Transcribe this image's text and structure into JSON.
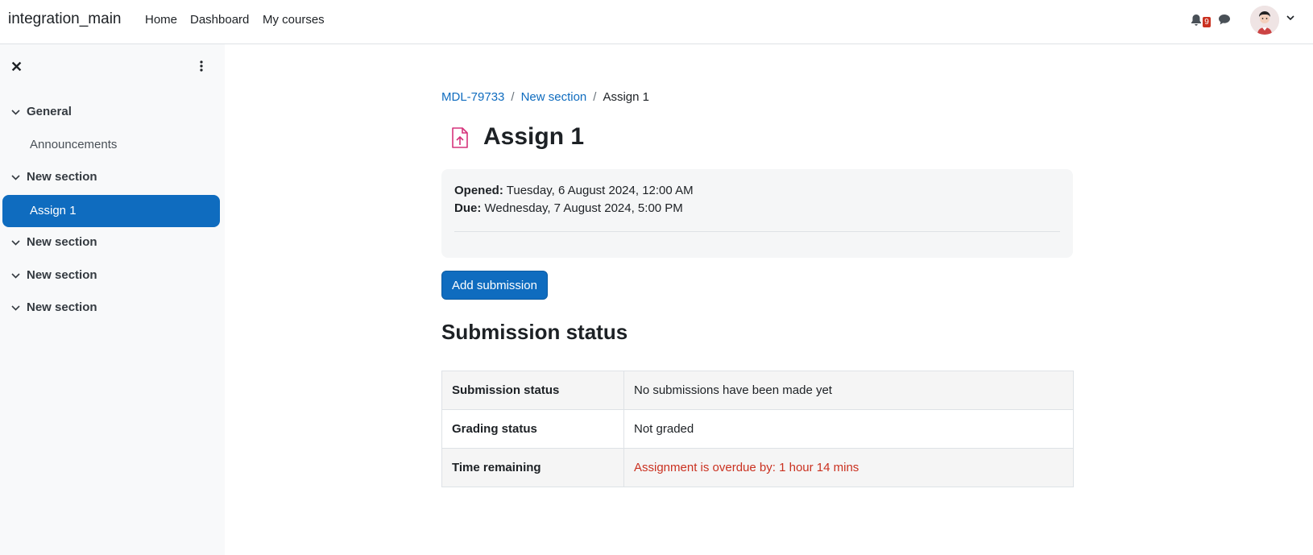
{
  "navbar": {
    "brand": "integration_main",
    "links": [
      "Home",
      "Dashboard",
      "My courses"
    ],
    "notification_count": "9"
  },
  "drawer": {
    "sections": [
      {
        "title": "General",
        "items": [
          "Announcements"
        ]
      },
      {
        "title": "New section",
        "items": [
          "Assign 1"
        ]
      },
      {
        "title": "New section",
        "items": []
      },
      {
        "title": "New section",
        "items": []
      },
      {
        "title": "New section",
        "items": []
      }
    ]
  },
  "breadcrumb": [
    "MDL-79733",
    "New section",
    "Assign 1"
  ],
  "page_title": "Assign 1",
  "dates": {
    "opened_label": "Opened:",
    "opened_value": "Tuesday, 6 August 2024, 12:00 AM",
    "due_label": "Due:",
    "due_value": "Wednesday, 7 August 2024, 5:00 PM"
  },
  "add_submission_label": "Add submission",
  "status_heading": "Submission status",
  "status_table": [
    {
      "label": "Submission status",
      "value": "No submissions have been made yet"
    },
    {
      "label": "Grading status",
      "value": "Not graded"
    },
    {
      "label": "Time remaining",
      "value": "Assignment is overdue by: 1 hour 14 mins"
    }
  ],
  "colors": {
    "primary": "#0f6cbf",
    "danger": "#ca3120",
    "icon_pink": "#d6337b"
  },
  "icons": [
    "bell-icon",
    "message-icon",
    "close-icon",
    "kebab-icon",
    "chevron-down-icon",
    "assignment-upload-icon"
  ]
}
